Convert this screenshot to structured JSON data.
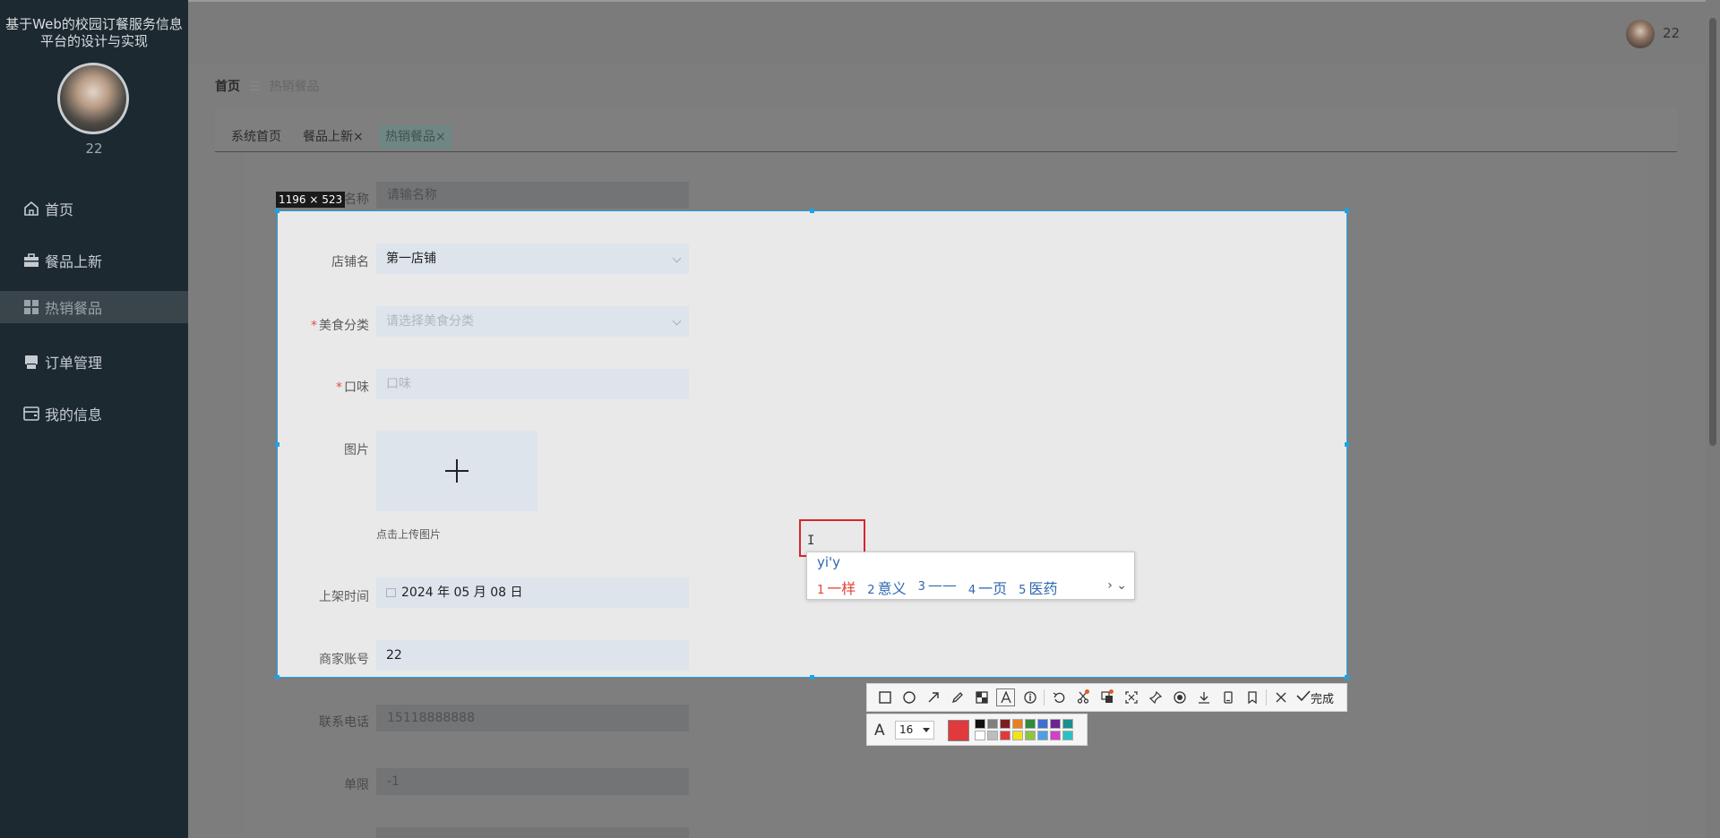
{
  "app_title": "基于Web的校园订餐服务信息平台的设计与实现",
  "sidebar": {
    "user_name": "22",
    "items": [
      {
        "label": "首页",
        "icon": "home-icon"
      },
      {
        "label": "餐品上新",
        "icon": "briefcase-icon"
      },
      {
        "label": "热销餐品",
        "icon": "grid-icon"
      },
      {
        "label": "订单管理",
        "icon": "printer-icon"
      },
      {
        "label": "我的信息",
        "icon": "wallet-icon"
      }
    ]
  },
  "header": {
    "user_name": "22"
  },
  "breadcrumb": {
    "home": "首页",
    "separator": "☰",
    "current": "热销餐品"
  },
  "tabs": [
    {
      "label": "系统首页"
    },
    {
      "label": "餐品上新",
      "close": "×"
    },
    {
      "label": "热销餐品",
      "close": "×"
    }
  ],
  "background_form": {
    "top_label": "名称",
    "top_placeholder": "请输名称",
    "phone_label": "联系电话",
    "phone_value": "15118888888",
    "limit_label": "单限",
    "limit_value": "-1"
  },
  "capture": {
    "dimensions": "1196 × 523",
    "form": {
      "shop_label": "店铺名",
      "shop_value": "第一店铺",
      "category_label": "美食分类",
      "category_placeholder": "请选择美食分类",
      "taste_label": "口味",
      "taste_placeholder": "口味",
      "image_label": "图片",
      "upload_hint": "点击上传图片",
      "listing_time_label": "上架时间",
      "listing_time_value": "2024 年 05 月 08 日",
      "merchant_label": "商家账号",
      "merchant_value": "22"
    },
    "required_mark": "*",
    "text_cursor": "I"
  },
  "ime": {
    "composition": "yi'y",
    "candidates": [
      {
        "num": "1",
        "text": "一样"
      },
      {
        "num": "2",
        "text": "意义"
      },
      {
        "num": "3",
        "text": "——"
      },
      {
        "num": "4",
        "text": "一页"
      },
      {
        "num": "5",
        "text": "医药"
      }
    ],
    "nav": "› ⌄"
  },
  "toolbar": {
    "done_label": "完成",
    "font_size": "16",
    "current_color": "#e0393e",
    "palette": [
      "#111111",
      "#7f7f7f",
      "#7e1f1f",
      "#e97e22",
      "#2e8b3a",
      "#3d6fd2",
      "#6e2492",
      "#1a8f8f",
      "#ffffff",
      "#bdbdbd",
      "#e23a3a",
      "#f2e21c",
      "#8dc63f",
      "#4aa0e6",
      "#d23fc8",
      "#27c3c3"
    ]
  }
}
